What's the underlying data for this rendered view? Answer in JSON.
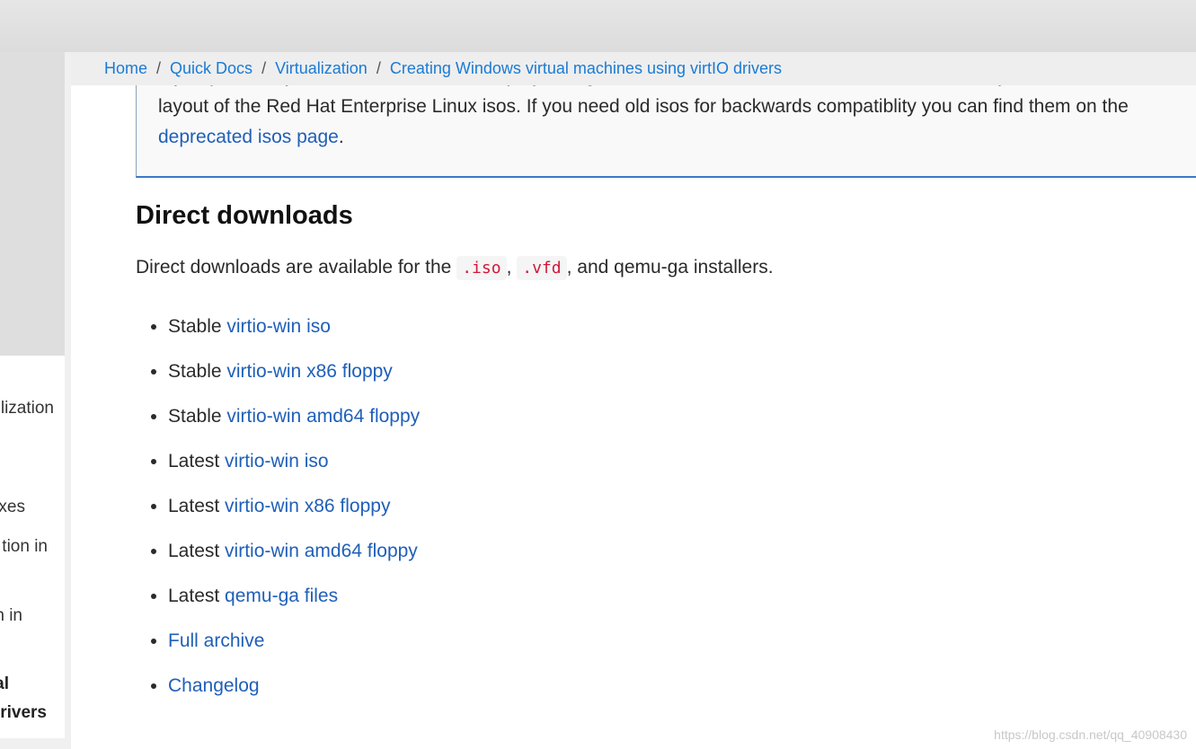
{
  "breadcrumb": [
    "Home",
    "Quick Docs",
    "Virtualization",
    "Creating Windows virtual machines using virtIO drivers"
  ],
  "breadcrumb_sep": "/",
  "sidebar_fragments": [
    "lization",
    "xes",
    "tion in",
    "n in",
    "al",
    "rivers"
  ],
  "note": {
    "line1": "If you previously used isos from alt.fedoraproject.org, note that the current isos have a different file layout that matches the",
    "line2": "layout of the Red Hat Enterprise Linux isos. If you need old isos for backwards compatiblity you can find them on the",
    "link": "deprecated isos page",
    "after": "."
  },
  "section": {
    "title": "Direct downloads",
    "intro_pre": "Direct downloads are available for the ",
    "code1": ".iso",
    "comma": ",",
    "code2": ".vfd",
    "intro_post": ", and qemu-ga installers.",
    "items": [
      {
        "prefix": "Stable ",
        "link": "virtio-win iso"
      },
      {
        "prefix": "Stable ",
        "link": "virtio-win x86 floppy"
      },
      {
        "prefix": "Stable ",
        "link": "virtio-win amd64 floppy"
      },
      {
        "prefix": "Latest ",
        "link": "virtio-win iso"
      },
      {
        "prefix": "Latest ",
        "link": "virtio-win x86 floppy"
      },
      {
        "prefix": "Latest ",
        "link": "virtio-win amd64 floppy"
      },
      {
        "prefix": "Latest ",
        "link": "qemu-ga files"
      },
      {
        "prefix": "",
        "link": "Full archive"
      },
      {
        "prefix": "",
        "link": "Changelog"
      }
    ]
  },
  "watermark": "https://blog.csdn.net/qq_40908430",
  "colors": {
    "link": "#1f5fb8",
    "breadcrumb_link": "#1a7bd6",
    "code": "#d0183a"
  }
}
